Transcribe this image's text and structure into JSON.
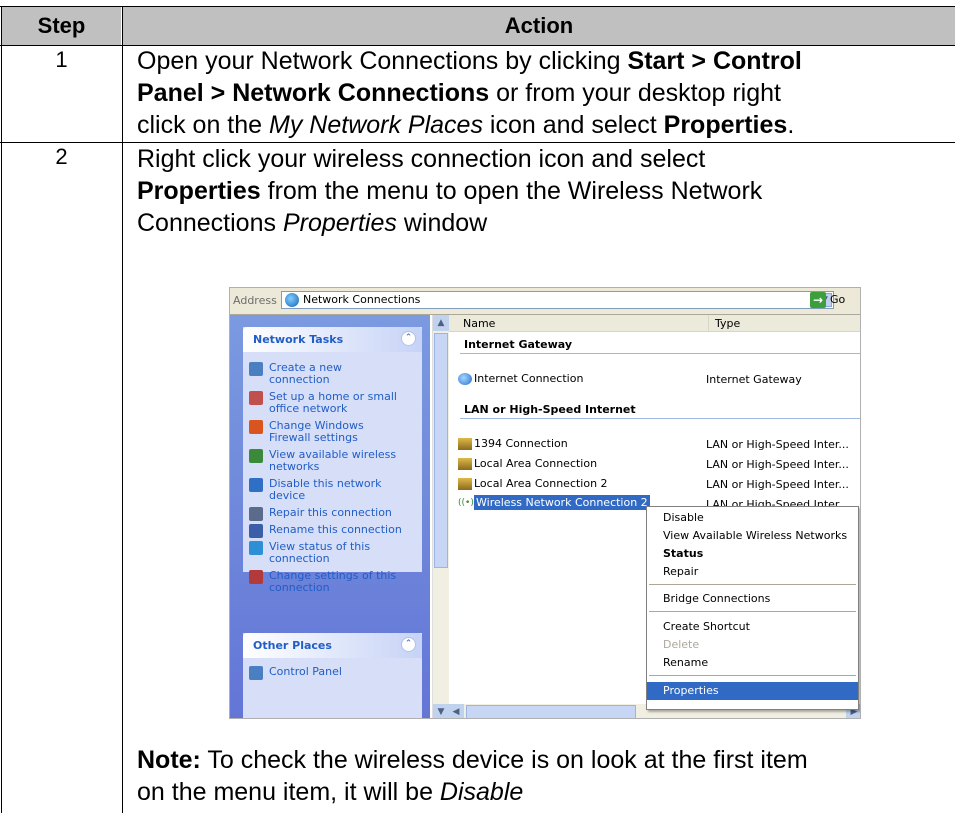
{
  "table": {
    "headers": {
      "step": "Step",
      "action": "Action"
    },
    "rows": [
      {
        "step": "1",
        "line1_a": "Open your Network Connections by clicking ",
        "line1_b": "Start > Control",
        "line2_a": "Panel > Network Connections",
        "line2_b": " or from your desktop right",
        "line3_a": "click on the ",
        "line3_b": "My Network Places",
        "line3_c": " icon and select ",
        "line3_d": "Properties",
        "line3_e": "."
      },
      {
        "step": "2",
        "line1": "Right click your wireless connection icon and select",
        "line2_a": "Properties",
        "line2_b": " from the menu to open the Wireless Network",
        "line3_a": "Connections ",
        "line3_b": "Properties",
        "line3_c": " window"
      }
    ],
    "note": {
      "label": "Note:",
      "line1": " To check the wireless device is on look at the first item",
      "line2_a": "on the menu item, it will be ",
      "line2_b": "Disable"
    }
  },
  "screenshot": {
    "address": {
      "label": "Address",
      "value": "Network Connections",
      "go": "Go"
    },
    "network_tasks": {
      "title": "Network Tasks",
      "items": [
        {
          "l1": "Create a new",
          "l2": "connection",
          "icon": "new-connection-icon",
          "color": "#4a7fc1"
        },
        {
          "l1": "Set up a home or small",
          "l2": "office network",
          "icon": "home-network-icon",
          "color": "#c0504d"
        },
        {
          "l1": "Change Windows",
          "l2": "Firewall settings",
          "icon": "firewall-icon",
          "color": "#d9541e"
        },
        {
          "l1": "View available wireless",
          "l2": "networks",
          "icon": "wireless-icon",
          "color": "#3b8a3b"
        },
        {
          "l1": "Disable this network",
          "l2": "device",
          "icon": "disable-device-icon",
          "color": "#2f6fc6"
        },
        {
          "l1": "Repair this connection",
          "l2": "",
          "icon": "repair-icon",
          "color": "#5b6b8c"
        },
        {
          "l1": "Rename this connection",
          "l2": "",
          "icon": "rename-icon",
          "color": "#3a5fa8"
        },
        {
          "l1": "View status of this",
          "l2": "connection",
          "icon": "status-icon",
          "color": "#2d8fd5"
        },
        {
          "l1": "Change settings of this",
          "l2": "connection",
          "icon": "settings-icon",
          "color": "#b33a3a"
        }
      ]
    },
    "other_places": {
      "title": "Other Places",
      "items": [
        {
          "l1": "Control Panel",
          "icon": "control-panel-icon",
          "color": "#4a7fc1"
        }
      ]
    },
    "columns": {
      "name": "Name",
      "type": "Type"
    },
    "groups": {
      "internet": "Internet Gateway",
      "lan": "LAN or High-Speed Internet"
    },
    "rows": {
      "internet_connection": {
        "name": "Internet Connection",
        "type": "Internet Gateway"
      },
      "c1394": {
        "name": "1394 Connection",
        "type": "LAN or High-Speed Inter..."
      },
      "local": {
        "name": "Local Area Connection",
        "type": "LAN or High-Speed Inter..."
      },
      "local2": {
        "name": "Local Area Connection 2",
        "type": "LAN or High-Speed Inter..."
      },
      "wireless2": {
        "name": "Wireless Network Connection 2",
        "type": "LAN or High-Speed Inter..."
      }
    },
    "context_menu": {
      "disable": "Disable",
      "view_wireless": "View Available Wireless Networks",
      "status": "Status",
      "repair": "Repair",
      "bridge": "Bridge Connections",
      "shortcut": "Create Shortcut",
      "delete": "Delete",
      "rename": "Rename",
      "properties": "Properties"
    }
  }
}
